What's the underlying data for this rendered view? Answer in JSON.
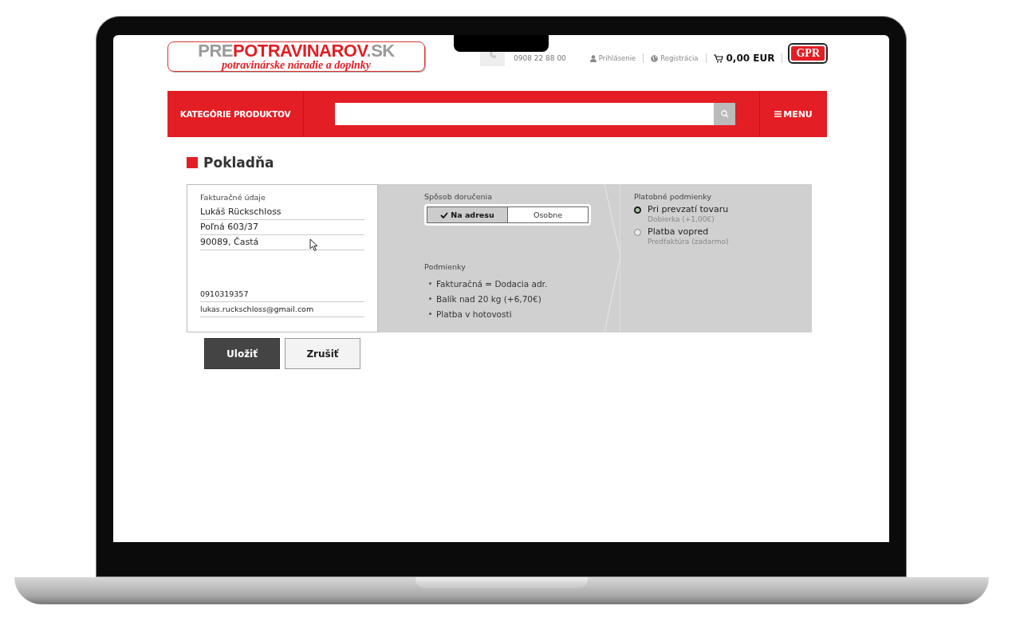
{
  "logo": {
    "prefix": "PRE",
    "main": "POTRAVINAROV",
    "suffix": ".SK",
    "slogan": "potravinárske náradie a doplnky"
  },
  "header": {
    "phone": "0908 22 88 00",
    "login": "Prihlásenie",
    "register": "Registrácia",
    "cart_total": "0,00 EUR",
    "badge": "GPR"
  },
  "navbar": {
    "categories": "KATEGÓRIE PRODUKTOV",
    "menu": "MENU"
  },
  "page_title": "Pokladňa",
  "billing": {
    "label": "Fakturačné údaje",
    "lines": [
      "Lukáš Rückschloss",
      "Poľná 603/37",
      "90089, Častá"
    ],
    "phone": "0910319357",
    "email": "lukas.ruckschloss@gmail.com"
  },
  "delivery": {
    "label": "Spôsob doručenia",
    "options": [
      {
        "label": "Na adresu",
        "selected": true
      },
      {
        "label": "Osobne",
        "selected": false
      }
    ]
  },
  "conditions": {
    "label": "Podmienky",
    "items": [
      "Fakturačná = Dodacia adr.",
      "Balík nad 20 kg (+6,70€)",
      "Platba v hotovosti"
    ]
  },
  "payment": {
    "label": "Platobné podmienky",
    "options": [
      {
        "label": "Pri prevzatí tovaru",
        "note": "Dobierka (+1,00€)",
        "selected": true
      },
      {
        "label": "Platba vopred",
        "note": "Predfaktúra (zadarmo)",
        "selected": false
      }
    ]
  },
  "buttons": [
    {
      "label": "Uložiť",
      "kind": "primary"
    },
    {
      "label": "Zrušiť",
      "kind": "secondary"
    }
  ]
}
